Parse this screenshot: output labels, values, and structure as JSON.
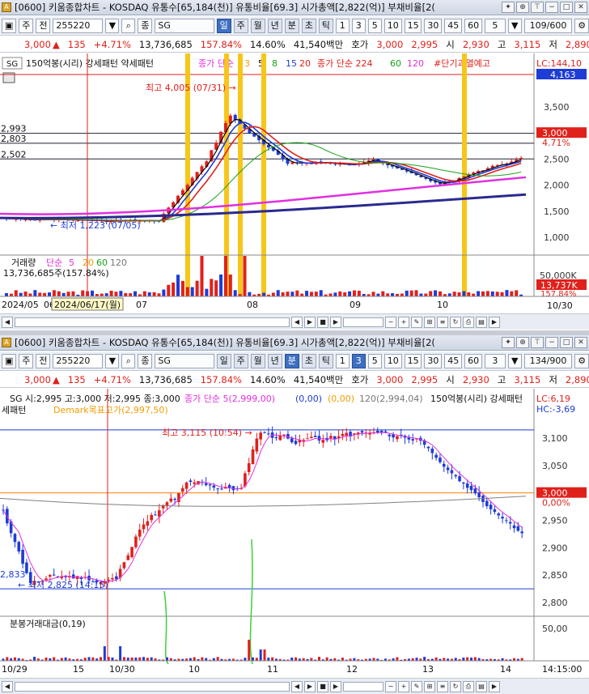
{
  "daily": {
    "title": "[0600] 키움종합차트 - KOSDAQ 유통수[65,184(천)] 유통비율[69.3] 시가총액[2,822(억)] 부채비율[2(",
    "toolbar": {
      "type_label": "주",
      "prev_label": "전",
      "code": "255220",
      "search_label": "Q",
      "stock_label": "종",
      "stock_name": "SG",
      "periods": [
        "일",
        "주",
        "월",
        "년",
        "분",
        "초",
        "틱"
      ],
      "active_period": "일",
      "intervals": [
        "1",
        "3",
        "5",
        "10",
        "15",
        "30",
        "45",
        "60"
      ],
      "interval_value": "5",
      "count": "109/600"
    },
    "quote": {
      "price": "3,000",
      "arrow": "▲",
      "change": "135",
      "change_pct": "+4.71%",
      "volume": "13,736,685",
      "volume_pct": "157.84%",
      "turnover": "14.60%",
      "amount": "41,540백만",
      "ask_label": "호가",
      "ask": "3,000",
      "bid": "2,995",
      "open_label": "시",
      "open": "2,930",
      "high_label": "고",
      "high": "3,115",
      "low_label": "저",
      "low": "2,890"
    },
    "legend": {
      "sg_box": "SG",
      "name": "150억봉(시리) 강세패턴 약세패턴",
      "ma_label": "종가 단순",
      "ma_periods": [
        "3",
        "5",
        "8",
        "15",
        "20"
      ],
      "ma2_label": "종가 단순 224",
      "ma2_periods": [
        "60",
        "120"
      ],
      "signal": "#단기과열예고"
    },
    "lc_label": "LC:144,10",
    "lc_value": "4,163",
    "price_axis": [
      "3,500",
      "3,000",
      "2,500",
      "2,000",
      "1,500",
      "1,000"
    ],
    "hlines": [
      "2,993",
      "2,803",
      "2,502"
    ],
    "price_tag": "3,000",
    "pct_tag": "4.71%",
    "max_annot": "최고 4,005 (07/31)",
    "min_annot": "최저 1,223 (07/05)",
    "volume_legend": {
      "label": "거래량",
      "ma_label": "단순",
      "ma_periods": [
        "5",
        "20",
        "60",
        "120"
      ],
      "summary": "13,736,685주(157.84%)"
    },
    "vol_axis": "50,000K",
    "vol_tag": "13,737K",
    "vol_pct_tag": "157.84%",
    "date_labels": [
      "2024/05",
      "06",
      "07",
      "08",
      "09",
      "10"
    ],
    "cursor_date": "2024/06/17(월)",
    "last_date": "10/30",
    "colors": {
      "up": "#e0201b",
      "down": "#1e3cd6",
      "signal": "#f7c61a",
      "ma224": "#2a2a8f",
      "ma120": "#e030e0"
    }
  },
  "minute": {
    "title": "[0600] 키움종합차트 - KOSDAQ 유통수[65,184(천)] 유통비율[69.3] 시가총액[2,822(억)] 부채비율[2(",
    "toolbar": {
      "type_label": "주",
      "prev_label": "전",
      "code": "255220",
      "search_label": "Q",
      "stock_label": "종",
      "stock_name": "SG",
      "periods": [
        "일",
        "주",
        "월",
        "년",
        "분",
        "초",
        "틱"
      ],
      "active_period": "분",
      "intervals": [
        "1",
        "3",
        "5",
        "10",
        "15",
        "30",
        "45",
        "60"
      ],
      "active_interval": "3",
      "interval_value": "3",
      "count": "134/900"
    },
    "quote": {
      "price": "3,000",
      "arrow": "▲",
      "change": "135",
      "change_pct": "+4.71%",
      "volume": "13,736,685",
      "volume_pct": "157.84%",
      "turnover": "14.60%",
      "amount": "41,540백만",
      "ask_label": "호가",
      "ask": "3,000",
      "bid": "2,995",
      "open_label": "시",
      "open": "2,930",
      "high_label": "고",
      "high": "3,115",
      "low_label": "저",
      "low": "2,890"
    },
    "legend": {
      "ohlc": "SG 시:2,995 고:3,000 저:2,995 종:3,000",
      "ma_label": "종가 단순 5(2,999,00)",
      "v1": "(0,00)",
      "v2": "(0,00)",
      "v3": "120(2,994,04)",
      "name": "150억봉(시리) 강세패턴",
      "line2": "세패턴",
      "demark": "Demark목표고가(2,997,50)"
    },
    "lc_label": "LC:6,19",
    "hc_label": "HC:-3,69",
    "price_axis": [
      "3,100",
      "3,050",
      "3,000",
      "2,950",
      "2,900",
      "2,850",
      "2,800"
    ],
    "price_tag": "3,000",
    "pct_tag": "0,00%",
    "max_annot": "최고 3,115 (10:54)",
    "min_annot": "최저 2,825 (14:15)",
    "left_value": "2,833",
    "volume_legend": {
      "label": "분봉거래대금(0,19)"
    },
    "vol_axis": "50,00",
    "date_labels": [
      "10/29",
      "15",
      "10/30",
      "10",
      "11",
      "12",
      "13",
      "14"
    ],
    "last_time": "14:15:00",
    "colors": {
      "up": "#e0201b",
      "down": "#1e3cd6",
      "ma": "#e030e0",
      "ma120": "#808080",
      "level": "#ff8000"
    }
  }
}
